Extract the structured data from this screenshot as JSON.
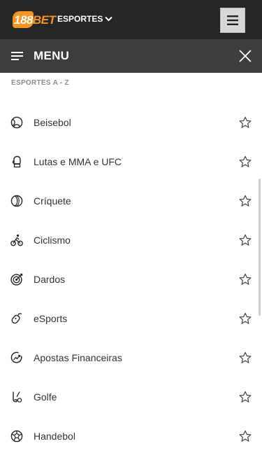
{
  "header": {
    "logo_main": "188",
    "logo_accent": "BET",
    "sports_dropdown_label": "ESPORTES"
  },
  "menu": {
    "title": "MENU"
  },
  "section": {
    "label": "ESPORTES A - Z"
  },
  "sports": [
    {
      "label": "Beisebol",
      "icon": "baseball-icon"
    },
    {
      "label": "Lutas e MMA e UFC",
      "icon": "boxing-glove-icon"
    },
    {
      "label": "Críquete",
      "icon": "cricket-ball-icon"
    },
    {
      "label": "Ciclismo",
      "icon": "cyclist-icon"
    },
    {
      "label": "Dardos",
      "icon": "dartboard-icon"
    },
    {
      "label": "eSports",
      "icon": "game-controller-icon"
    },
    {
      "label": "Apostas Financeiras",
      "icon": "financial-chart-icon"
    },
    {
      "label": "Golfe",
      "icon": "golf-club-icon"
    },
    {
      "label": "Handebol",
      "icon": "handball-icon"
    }
  ],
  "colors": {
    "topbar": "#262626",
    "menubar": "#3d3d3d",
    "brand_orange": "#f7931e"
  }
}
